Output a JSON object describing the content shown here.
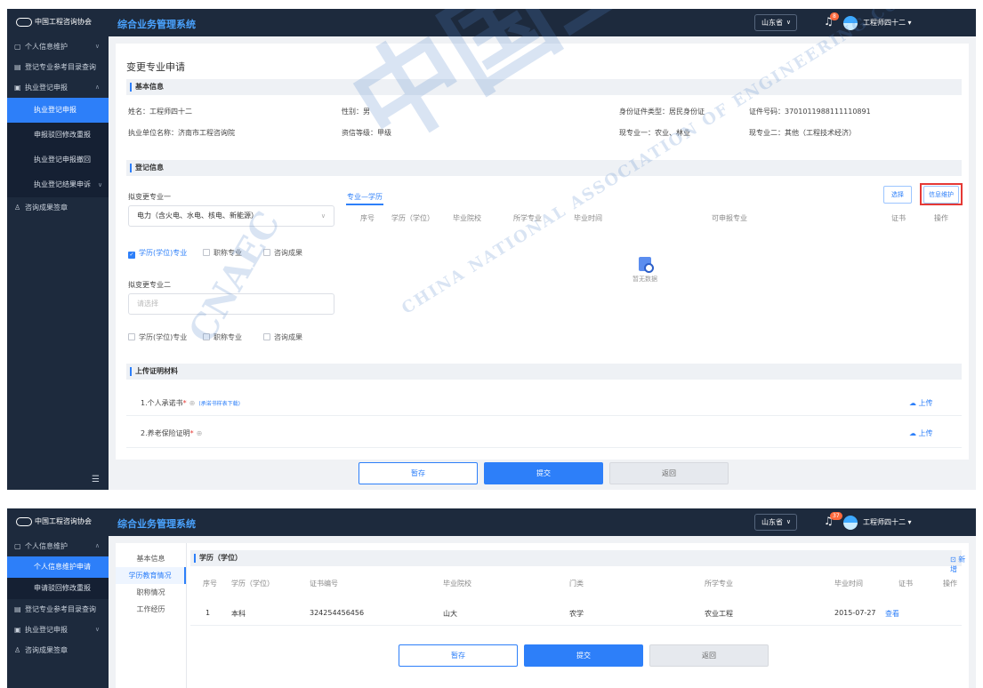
{
  "header": {
    "logo_text": "中国工程咨询协会",
    "system_title": "综合业务管理系统",
    "province": "山东省",
    "user_name": "工程师四十二"
  },
  "screen1": {
    "notif_count": "8",
    "sidebar": {
      "group1": "个人信息维护",
      "item_catalog": "登记专业参考目录查询",
      "group2": "执业登记申报",
      "subs": [
        "执业登记申报",
        "申报驳回修改重报",
        "执业登记申报撤回",
        "执业登记结果申诉"
      ],
      "item_seal": "咨询成果签章"
    },
    "page_title": "变更专业申请",
    "basic": {
      "section": "基本信息",
      "name": "姓名：工程师四十二",
      "gender": "性别：男",
      "id_type": "身份证件类型：居民身份证",
      "id_no": "证件号码：370101198811111089​1",
      "company": "执业单位名称：济南市工程咨询院",
      "qualification": "资信等级：甲级",
      "major1": "现专业一：农业、林业",
      "major2": "现专业二：其他（工程技术经济）"
    },
    "register": {
      "section": "登记信息",
      "label1": "拟变更专业一",
      "select1": "电力（含火电、水电、核电、新能源）",
      "tab": "专业—学历",
      "select_btn": "选择",
      "maintain_btn": "信息维护",
      "columns": [
        "序号",
        "学历（学位）",
        "毕业院校",
        "所学专业",
        "毕业时间",
        "可申报专业",
        "证书",
        "操作"
      ],
      "empty": "暂无数据",
      "checks": [
        "学历(学位)专业",
        "职称专业",
        "咨询成果"
      ],
      "label2": "拟变更专业二",
      "select2_placeholder": "请选择"
    },
    "upload": {
      "section": "上传证明材料",
      "doc1": "1.个人承诺书",
      "doc1_link": "(承诺书样表下载)",
      "doc2": "2.养老保险证明",
      "action": "上传"
    },
    "buttons": {
      "save": "暂存",
      "submit": "提交",
      "back": "返回"
    }
  },
  "screen2": {
    "notif_count": "37",
    "sidebar": {
      "group1": "个人信息维护",
      "subs": [
        "个人信息维护申请",
        "申请驳回修改重报"
      ],
      "item_catalog": "登记专业参考目录查询",
      "group2": "执业登记申报",
      "item_seal": "咨询成果签章"
    },
    "subnav": [
      "基本信息",
      "学历教育情况",
      "职称情况",
      "工作经历"
    ],
    "section": "学历（学位）",
    "add": "新增",
    "columns": [
      "序号",
      "学历（学位）",
      "证书编号",
      "毕业院校",
      "门类",
      "所学专业",
      "毕业时间",
      "证书",
      "操作"
    ],
    "row": {
      "no": "1",
      "degree": "本科",
      "cert_no": "324254456456",
      "school": "山大",
      "category": "农学",
      "major": "农业工程",
      "date": "2015-07-27",
      "cert": "查看"
    },
    "buttons": {
      "save": "暂存",
      "submit": "提交",
      "back": "返回"
    }
  },
  "watermark": {
    "cn": "中国工程咨询协会",
    "en": "CHINA NATIONAL ASSOCIATION OF ENGINEERING CONSULTANTS",
    "abbr": "CNAEC"
  },
  "icons": [
    "chevron-down-icon",
    "bell-icon",
    "user-avatar",
    "collapse-menu-icon",
    "empty-data-icon",
    "cloud-upload-icon",
    "help-icon",
    "add-icon"
  ],
  "colors": {
    "header_bg": "#1d2a3d",
    "primary": "#2d7ff9",
    "title_blue": "#4aa3ff",
    "alert_red": "#e53935",
    "badge": "#ff6a3d"
  }
}
